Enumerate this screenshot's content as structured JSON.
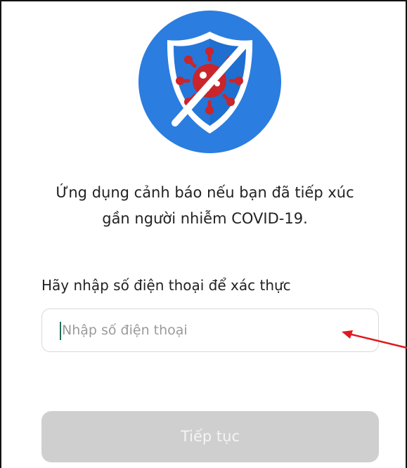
{
  "app": {
    "logo_icon": "shield-virus-blocked-icon",
    "colors": {
      "logo_circle": "#2b7de0",
      "virus": "#c9252b",
      "button_disabled": "#cfcfcf",
      "caret": "#1f6f5c",
      "annotation_arrow": "#e0181f"
    }
  },
  "intro": {
    "line1": "Ứng dụng cảnh báo nếu bạn đã tiếp xúc",
    "line2": "gần người nhiễm COVID-19."
  },
  "form": {
    "prompt": "Hãy nhập số điện thoại để xác thực",
    "phone_placeholder": "Nhập số điện thoại",
    "phone_value": "",
    "continue_label": "Tiếp tục",
    "continue_enabled": false
  },
  "annotation": {
    "icon": "red-arrow-icon"
  }
}
